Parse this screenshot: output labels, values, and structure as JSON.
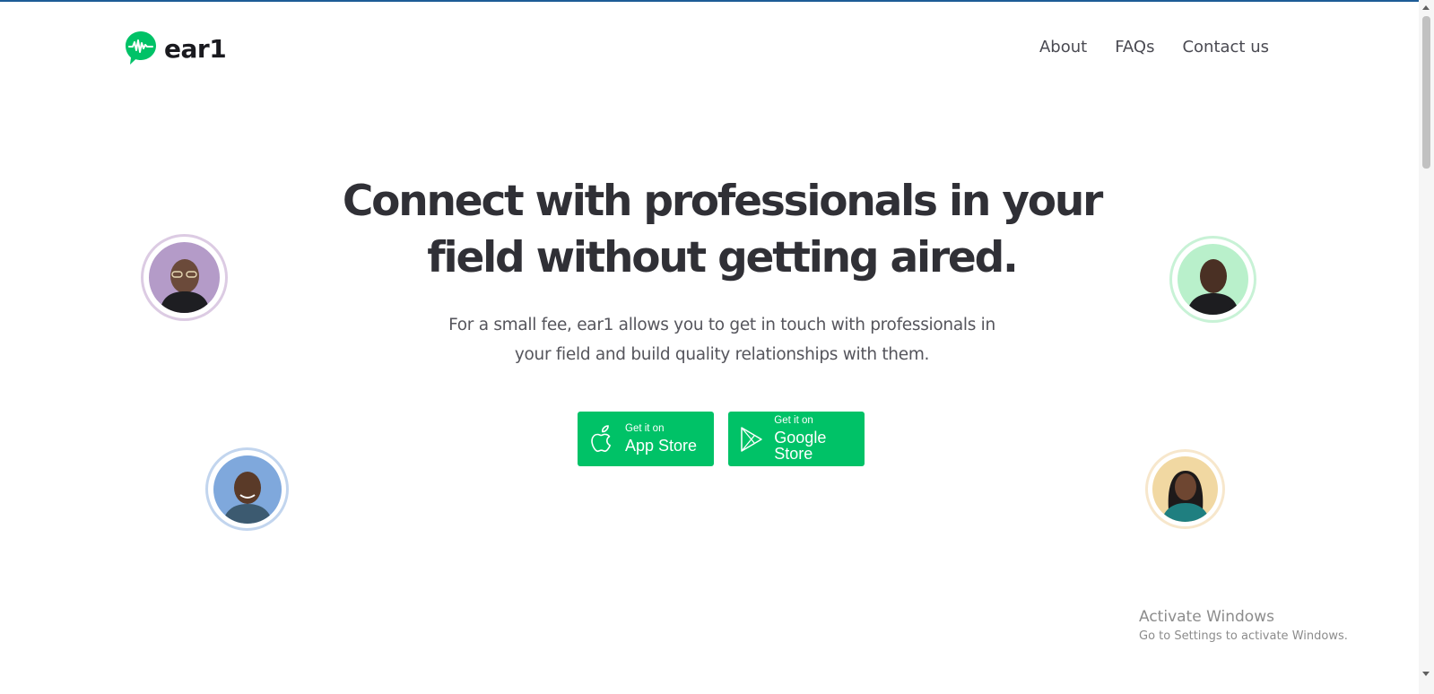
{
  "brand": {
    "name": "ear1",
    "accent": "#00c267"
  },
  "nav": {
    "items": [
      {
        "label": "About"
      },
      {
        "label": "FAQs"
      },
      {
        "label": "Contact us"
      }
    ]
  },
  "hero": {
    "title_line1": "Connect with professionals in your",
    "title_line2": "field without getting aired.",
    "subtitle_line1": "For a small fee, ear1 allows you to get in touch with professionals in",
    "subtitle_line2": "your field and build quality relationships with them."
  },
  "store_buttons": {
    "app": {
      "small": "Get it on",
      "big": "App Store",
      "icon": "apple-icon"
    },
    "google": {
      "small": "Get it on",
      "big": "Google Store",
      "icon": "play-icon"
    }
  },
  "avatars": [
    {
      "id": "avatar-top-left",
      "bg": "#b49bc8",
      "ring": "#dccbe3"
    },
    {
      "id": "avatar-bottom-left",
      "bg": "#7fa8dc",
      "ring": "#c2d5ee"
    },
    {
      "id": "avatar-top-right",
      "bg": "#b9f0cb",
      "ring": "#c8f2d6"
    },
    {
      "id": "avatar-bottom-right",
      "bg": "#f1d8a2",
      "ring": "#f7e7cc"
    }
  ],
  "watermark": {
    "title": "Activate Windows",
    "subtitle": "Go to Settings to activate Windows."
  }
}
